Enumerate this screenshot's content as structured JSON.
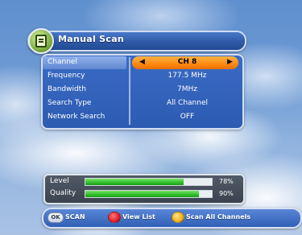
{
  "header": {
    "title": "Manual Scan",
    "icon": "scan-settings-icon"
  },
  "menu": {
    "rows": [
      {
        "label": "Channel",
        "value": "CH 8",
        "selected": true
      },
      {
        "label": "Frequency",
        "value": "177.5 MHz"
      },
      {
        "label": "Bandwidth",
        "value": "7MHz"
      },
      {
        "label": "Search Type",
        "value": "All Channel"
      },
      {
        "label": "Network Search",
        "value": "OFF"
      }
    ],
    "left_arrow": "◀",
    "right_arrow": "▶"
  },
  "signal": {
    "level_label": "Level",
    "level_value": "78%",
    "level_fraction": 0.78,
    "quality_label": "Quality",
    "quality_value": "90%",
    "quality_fraction": 0.9
  },
  "hints": {
    "ok_key": "OK",
    "ok_label": "SCAN",
    "red_label": "View List",
    "yellow_label": "Scan All Channels",
    "red_color": "#e0202a",
    "yellow_color": "#f2b21a"
  }
}
